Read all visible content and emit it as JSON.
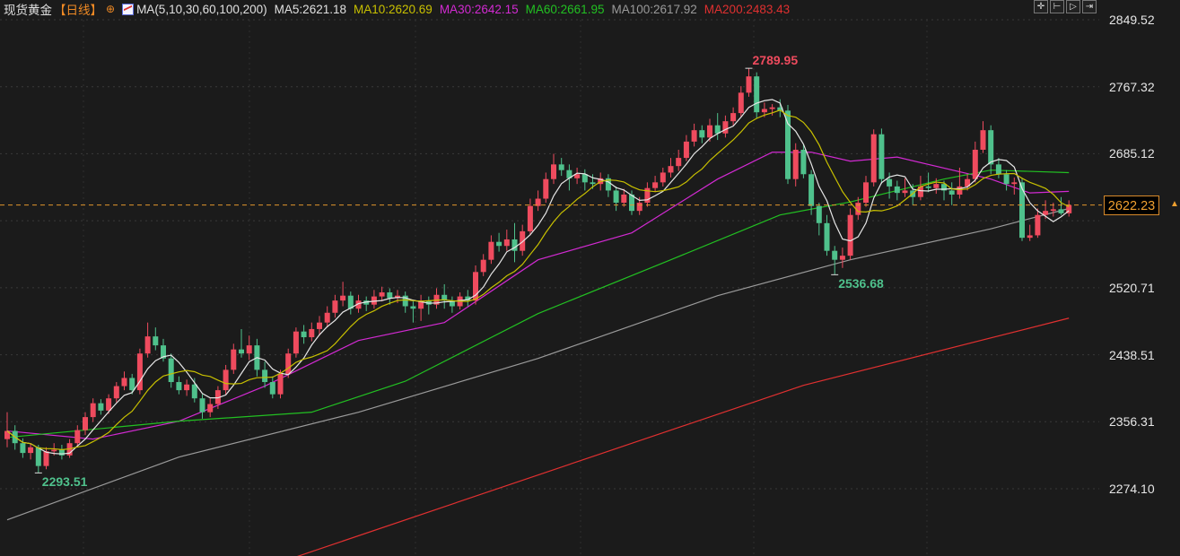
{
  "header": {
    "title": "现货黄金",
    "period": "【日线】",
    "settings_icon": "crosshair-settings-icon",
    "ma_def": "MA(5,10,30,60,100,200)",
    "ma_values": [
      {
        "label": "MA5:2621.18",
        "color": "#e0e0e0"
      },
      {
        "label": "MA10:2620.69",
        "color": "#c8c000"
      },
      {
        "label": "MA30:2642.15",
        "color": "#d22ad2"
      },
      {
        "label": "MA60:2661.95",
        "color": "#22c022"
      },
      {
        "label": "MA100:2617.92",
        "color": "#9a9a9a"
      },
      {
        "label": "MA200:2483.43",
        "color": "#e03030"
      }
    ]
  },
  "toolbar": {
    "icons": [
      "crosshair-icon",
      "zoom-to-start-icon",
      "play-icon",
      "jump-to-end-icon"
    ]
  },
  "colors": {
    "up": "#ef4b5e",
    "down": "#4fc18c",
    "background": "#1b1b1b",
    "current": "#e0962c"
  },
  "chart_data": {
    "type": "candlestick",
    "title": "现货黄金 日线",
    "y_ticks": [
      "2849.52",
      "2767.32",
      "2685.12",
      "2520.71",
      "2438.51",
      "2356.31",
      "2274.10"
    ],
    "hidden_tick": 2602.92,
    "ylim": [
      2274.1,
      2849.52
    ],
    "current_price": "2622.23",
    "annotations": [
      {
        "label": "2789.95",
        "index": 95,
        "value": 2789.95,
        "kind": "high"
      },
      {
        "label": "2536.68",
        "index": 106,
        "value": 2536.68,
        "kind": "low"
      },
      {
        "label": "2293.51",
        "index": 4,
        "value": 2293.51,
        "kind": "low"
      }
    ],
    "ohlc": [
      [
        2335,
        2368,
        2325,
        2345
      ],
      [
        2345,
        2352,
        2322,
        2330
      ],
      [
        2330,
        2336,
        2312,
        2318
      ],
      [
        2318,
        2330,
        2310,
        2325
      ],
      [
        2325,
        2328,
        2293.51,
        2302
      ],
      [
        2302,
        2325,
        2298,
        2320
      ],
      [
        2320,
        2330,
        2315,
        2322
      ],
      [
        2322,
        2328,
        2310,
        2315
      ],
      [
        2315,
        2335,
        2312,
        2330
      ],
      [
        2330,
        2352,
        2325,
        2346
      ],
      [
        2346,
        2368,
        2340,
        2362
      ],
      [
        2362,
        2385,
        2356,
        2379
      ],
      [
        2379,
        2384,
        2365,
        2370
      ],
      [
        2370,
        2390,
        2366,
        2385
      ],
      [
        2385,
        2405,
        2380,
        2400
      ],
      [
        2400,
        2418,
        2395,
        2410
      ],
      [
        2410,
        2415,
        2390,
        2395
      ],
      [
        2395,
        2446,
        2390,
        2440
      ],
      [
        2440,
        2478,
        2435,
        2461
      ],
      [
        2461,
        2472,
        2444,
        2450
      ],
      [
        2450,
        2458,
        2430,
        2434
      ],
      [
        2434,
        2440,
        2398,
        2405
      ],
      [
        2405,
        2412,
        2390,
        2395
      ],
      [
        2395,
        2408,
        2388,
        2402
      ],
      [
        2402,
        2410,
        2380,
        2385
      ],
      [
        2385,
        2390,
        2360,
        2368
      ],
      [
        2368,
        2385,
        2362,
        2378
      ],
      [
        2378,
        2400,
        2372,
        2395
      ],
      [
        2395,
        2426,
        2390,
        2420
      ],
      [
        2420,
        2452,
        2415,
        2445
      ],
      [
        2445,
        2470,
        2435,
        2440
      ],
      [
        2440,
        2462,
        2432,
        2450
      ],
      [
        2450,
        2458,
        2412,
        2420
      ],
      [
        2420,
        2430,
        2398,
        2405
      ],
      [
        2405,
        2412,
        2385,
        2390
      ],
      [
        2390,
        2420,
        2385,
        2415
      ],
      [
        2415,
        2446,
        2410,
        2440
      ],
      [
        2440,
        2472,
        2435,
        2467
      ],
      [
        2467,
        2475,
        2452,
        2460
      ],
      [
        2460,
        2478,
        2455,
        2470
      ],
      [
        2470,
        2486,
        2462,
        2478
      ],
      [
        2478,
        2498,
        2472,
        2490
      ],
      [
        2490,
        2512,
        2484,
        2505
      ],
      [
        2505,
        2528,
        2498,
        2511
      ],
      [
        2511,
        2516,
        2488,
        2495
      ],
      [
        2495,
        2512,
        2490,
        2505
      ],
      [
        2505,
        2510,
        2492,
        2500
      ],
      [
        2500,
        2518,
        2495,
        2510
      ],
      [
        2510,
        2522,
        2504,
        2515
      ],
      [
        2515,
        2520,
        2500,
        2508
      ],
      [
        2508,
        2518,
        2502,
        2511
      ],
      [
        2511,
        2516,
        2490,
        2498
      ],
      [
        2498,
        2504,
        2478,
        2495
      ],
      [
        2495,
        2512,
        2480,
        2505
      ],
      [
        2505,
        2510,
        2488,
        2500
      ],
      [
        2500,
        2520,
        2495,
        2512
      ],
      [
        2512,
        2525,
        2495,
        2505
      ],
      [
        2505,
        2510,
        2490,
        2498
      ],
      [
        2498,
        2515,
        2494,
        2510
      ],
      [
        2510,
        2518,
        2498,
        2505
      ],
      [
        2505,
        2548,
        2500,
        2540
      ],
      [
        2540,
        2562,
        2535,
        2555
      ],
      [
        2555,
        2585,
        2550,
        2577
      ],
      [
        2577,
        2588,
        2565,
        2572
      ],
      [
        2572,
        2592,
        2566,
        2580
      ],
      [
        2580,
        2600,
        2552,
        2566
      ],
      [
        2566,
        2598,
        2560,
        2590
      ],
      [
        2590,
        2630,
        2585,
        2621
      ],
      [
        2621,
        2640,
        2615,
        2630
      ],
      [
        2630,
        2662,
        2625,
        2654
      ],
      [
        2654,
        2685,
        2648,
        2672
      ],
      [
        2672,
        2680,
        2658,
        2665
      ],
      [
        2665,
        2672,
        2640,
        2655
      ],
      [
        2655,
        2668,
        2648,
        2660
      ],
      [
        2660,
        2666,
        2640,
        2650
      ],
      [
        2650,
        2660,
        2642,
        2648
      ],
      [
        2648,
        2662,
        2640,
        2655
      ],
      [
        2655,
        2660,
        2632,
        2640
      ],
      [
        2640,
        2645,
        2615,
        2625
      ],
      [
        2625,
        2642,
        2620,
        2635
      ],
      [
        2635,
        2640,
        2610,
        2615
      ],
      [
        2615,
        2632,
        2610,
        2625
      ],
      [
        2625,
        2650,
        2620,
        2643
      ],
      [
        2643,
        2658,
        2638,
        2650
      ],
      [
        2650,
        2668,
        2645,
        2662
      ],
      [
        2662,
        2680,
        2656,
        2670
      ],
      [
        2670,
        2690,
        2664,
        2680
      ],
      [
        2680,
        2708,
        2676,
        2700
      ],
      [
        2700,
        2722,
        2694,
        2714
      ],
      [
        2714,
        2720,
        2698,
        2705
      ],
      [
        2705,
        2728,
        2700,
        2720
      ],
      [
        2720,
        2735,
        2702,
        2710
      ],
      [
        2710,
        2732,
        2705,
        2725
      ],
      [
        2725,
        2742,
        2720,
        2735
      ],
      [
        2735,
        2768,
        2730,
        2760
      ],
      [
        2760,
        2789.95,
        2755,
        2780
      ],
      [
        2780,
        2785,
        2728,
        2736
      ],
      [
        2736,
        2748,
        2730,
        2740
      ],
      [
        2740,
        2746,
        2732,
        2742
      ],
      [
        2742,
        2752,
        2730,
        2738
      ],
      [
        2738,
        2745,
        2648,
        2654
      ],
      [
        2654,
        2698,
        2645,
        2690
      ],
      [
        2690,
        2696,
        2655,
        2660
      ],
      [
        2660,
        2665,
        2610,
        2621
      ],
      [
        2621,
        2625,
        2585,
        2600
      ],
      [
        2600,
        2610,
        2560,
        2566
      ],
      [
        2566,
        2572,
        2536.68,
        2555
      ],
      [
        2555,
        2570,
        2545,
        2560
      ],
      [
        2560,
        2618,
        2555,
        2610
      ],
      [
        2610,
        2632,
        2604,
        2625
      ],
      [
        2625,
        2658,
        2620,
        2650
      ],
      [
        2650,
        2715,
        2645,
        2709
      ],
      [
        2709,
        2716,
        2648,
        2654
      ],
      [
        2654,
        2662,
        2630,
        2645
      ],
      [
        2645,
        2652,
        2628,
        2637
      ],
      [
        2637,
        2655,
        2632,
        2640
      ],
      [
        2640,
        2648,
        2622,
        2632
      ],
      [
        2632,
        2658,
        2628,
        2645
      ],
      [
        2645,
        2662,
        2638,
        2643
      ],
      [
        2643,
        2655,
        2636,
        2648
      ],
      [
        2648,
        2652,
        2628,
        2640
      ],
      [
        2640,
        2650,
        2622,
        2635
      ],
      [
        2635,
        2668,
        2630,
        2645
      ],
      [
        2645,
        2660,
        2640,
        2654
      ],
      [
        2654,
        2700,
        2650,
        2690
      ],
      [
        2690,
        2725,
        2686,
        2714
      ],
      [
        2714,
        2720,
        2660,
        2672
      ],
      [
        2672,
        2680,
        2655,
        2660
      ],
      [
        2660,
        2665,
        2640,
        2648
      ],
      [
        2648,
        2656,
        2635,
        2650
      ],
      [
        2650,
        2655,
        2578,
        2582
      ],
      [
        2582,
        2598,
        2578,
        2585
      ],
      [
        2585,
        2618,
        2582,
        2610
      ],
      [
        2610,
        2628,
        2605,
        2615
      ],
      [
        2615,
        2625,
        2608,
        2617
      ],
      [
        2617,
        2632,
        2610,
        2612
      ],
      [
        2612,
        2628,
        2608,
        2622.23
      ]
    ],
    "ma_series": [
      {
        "name": "MA30",
        "color": "#d22ad2",
        "points": [
          [
            0,
            2345
          ],
          [
            11,
            2335
          ],
          [
            22,
            2357
          ],
          [
            33,
            2400
          ],
          [
            45,
            2456
          ],
          [
            56,
            2478
          ],
          [
            68,
            2555
          ],
          [
            80,
            2588
          ],
          [
            91,
            2654
          ],
          [
            98,
            2687
          ],
          [
            103,
            2687
          ],
          [
            108,
            2676
          ],
          [
            114,
            2681
          ],
          [
            126,
            2654
          ],
          [
            131,
            2637
          ],
          [
            136,
            2639
          ]
        ]
      },
      {
        "name": "MA60",
        "color": "#22c022",
        "points": [
          [
            0,
            2337
          ],
          [
            22,
            2357
          ],
          [
            39,
            2368
          ],
          [
            51,
            2406
          ],
          [
            68,
            2489
          ],
          [
            85,
            2555
          ],
          [
            99,
            2610
          ],
          [
            108,
            2626
          ],
          [
            120,
            2654
          ],
          [
            126,
            2665
          ],
          [
            136,
            2661.95
          ]
        ]
      },
      {
        "name": "MA100",
        "color": "#9a9a9a",
        "points": [
          [
            0,
            2236
          ],
          [
            22,
            2313
          ],
          [
            45,
            2368
          ],
          [
            68,
            2434
          ],
          [
            91,
            2511
          ],
          [
            108,
            2555
          ],
          [
            126,
            2593
          ],
          [
            136,
            2617.92
          ]
        ]
      },
      {
        "name": "MA200",
        "color": "#e03030",
        "points": [
          [
            35,
            2184
          ],
          [
            68,
            2291
          ],
          [
            102,
            2401
          ],
          [
            136,
            2483.43
          ]
        ]
      }
    ],
    "computed_ma": [
      {
        "name": "MA5",
        "period": 5,
        "color": "#e6e6e6"
      },
      {
        "name": "MA10",
        "period": 10,
        "color": "#c8c000"
      }
    ]
  }
}
